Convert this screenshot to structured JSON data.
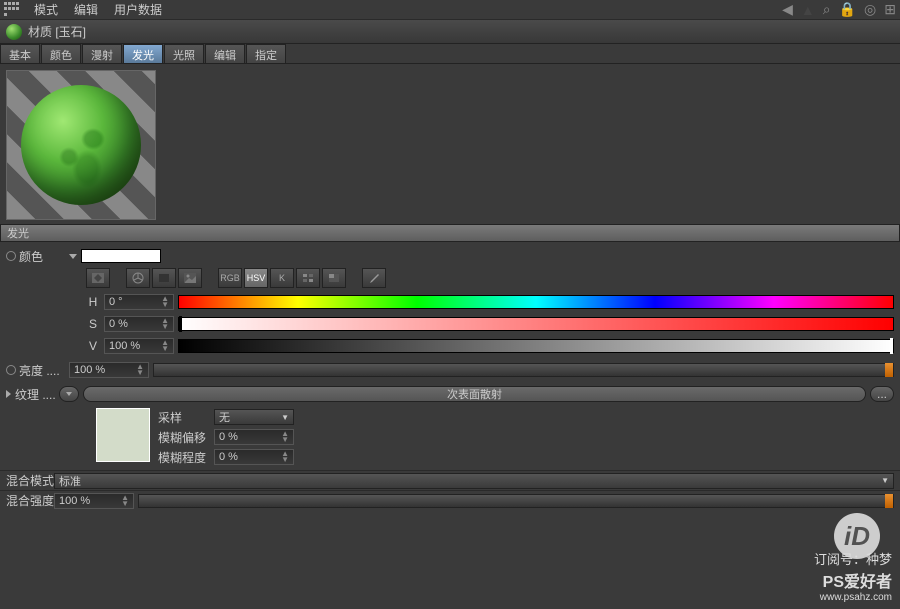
{
  "menubar": {
    "items": [
      "模式",
      "编辑",
      "用户数据"
    ]
  },
  "title": "材质 [玉石]",
  "tabs": [
    "基本",
    "颜色",
    "漫射",
    "发光",
    "光照",
    "编辑",
    "指定"
  ],
  "active_tab_index": 3,
  "section": {
    "title": "发光"
  },
  "color": {
    "label": "颜色",
    "mode_rgb": "RGB",
    "mode_hsv": "HSV",
    "mode_k": "K",
    "h_label": "H",
    "h_value": "0 °",
    "s_label": "S",
    "s_value": "0 %",
    "v_label": "V",
    "v_value": "100 %"
  },
  "brightness": {
    "label": "亮度",
    "value": "100 %"
  },
  "texture": {
    "label": "纹理",
    "name": "次表面散射",
    "more": "...",
    "sample_label": "采样",
    "sample_value": "无",
    "blur_offset_label": "模糊偏移",
    "blur_offset_value": "0 %",
    "blur_scale_label": "模糊程度",
    "blur_scale_value": "0 %"
  },
  "blend_mode": {
    "label": "混合模式",
    "value": "标准"
  },
  "blend_strength": {
    "label": "混合强度",
    "value": "100 %"
  },
  "watermark": {
    "line1": "订阅号：种梦",
    "line2": "PS爱好者",
    "url": "www.psahz.com"
  }
}
